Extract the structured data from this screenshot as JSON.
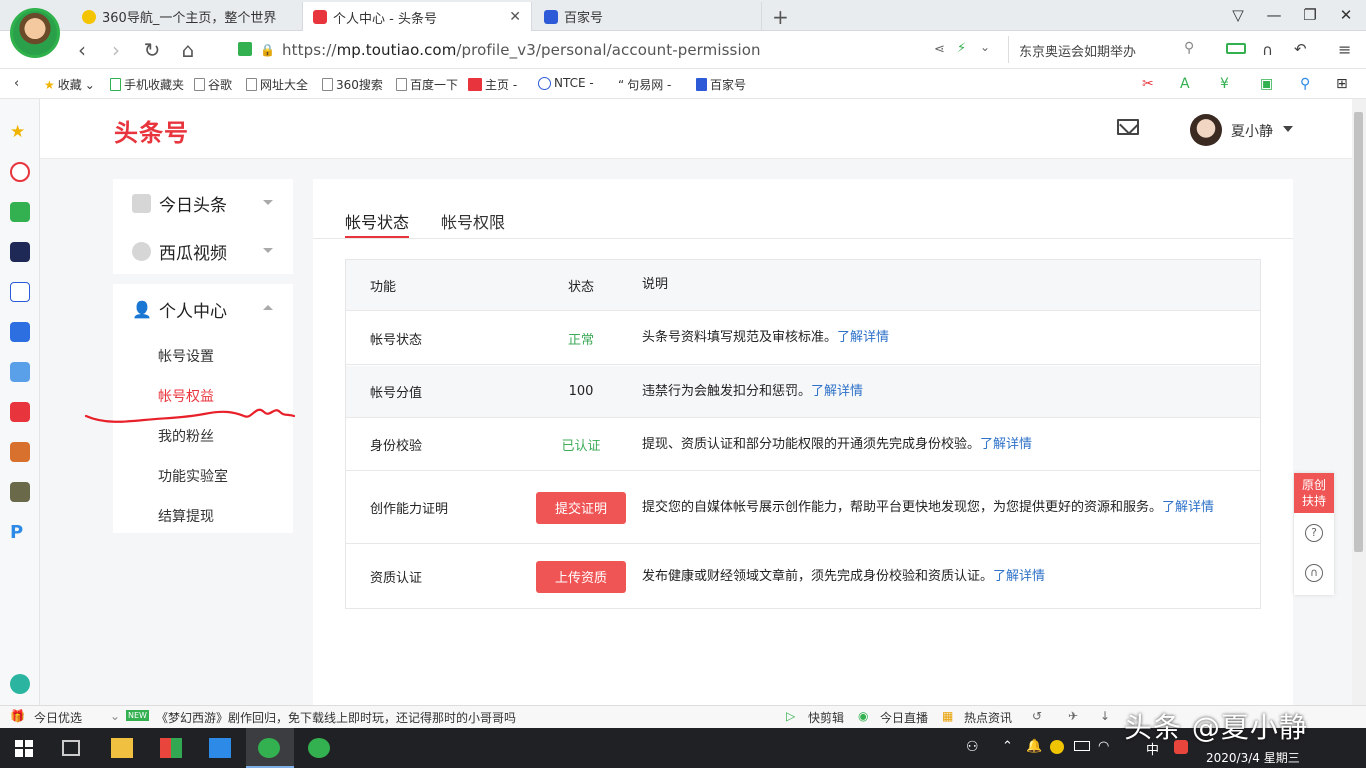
{
  "browser": {
    "tabs": [
      {
        "title": "360导航_一个主页，整个世界"
      },
      {
        "title": "个人中心 - 头条号"
      },
      {
        "title": "百家号"
      }
    ],
    "url_prefix": "https://",
    "url_domain": "mp.toutiao.com",
    "url_path": "/profile_v3/personal/account-permission",
    "search_text": "东京奥运会如期举办",
    "bookmarks": [
      "收藏",
      "手机收藏夹",
      "谷歌",
      "网址大全",
      "360搜索",
      "百度一下",
      "主页 -",
      "NTCE -",
      "句易网 -",
      "百家号"
    ]
  },
  "site": {
    "logo": "头条号",
    "user_name": "夏小静"
  },
  "left_nav": {
    "groups": [
      {
        "label": "今日头条"
      },
      {
        "label": "西瓜视频"
      },
      {
        "label": "个人中心"
      }
    ],
    "sub_items": [
      {
        "label": "帐号设置"
      },
      {
        "label": "帐号权益"
      },
      {
        "label": "我的粉丝"
      },
      {
        "label": "功能实验室"
      },
      {
        "label": "结算提现"
      }
    ]
  },
  "main": {
    "tabs": [
      {
        "label": "帐号状态"
      },
      {
        "label": "帐号权限"
      }
    ],
    "table": {
      "headers": [
        "功能",
        "状态",
        "说明"
      ],
      "rows": [
        {
          "feature": "帐号状态",
          "status": "正常",
          "desc": "头条号资料填写规范及审核标准。",
          "link": "了解详情"
        },
        {
          "feature": "帐号分值",
          "status": "100",
          "desc": "违禁行为会触发扣分和惩罚。",
          "link": "了解详情"
        },
        {
          "feature": "身份校验",
          "status": "已认证",
          "desc": "提现、资质认证和部分功能权限的开通须先完成身份校验。",
          "link": "了解详情"
        },
        {
          "feature": "创作能力证明",
          "action": "提交证明",
          "desc": "提交您的自媒体帐号展示创作能力，帮助平台更快地发现您，为您提供更好的资源和服务。",
          "link": "了解详情"
        },
        {
          "feature": "资质认证",
          "action": "上传资质",
          "desc": "发布健康或财经领域文章前，须先完成身份校验和资质认证。",
          "link": "了解详情"
        }
      ]
    }
  },
  "float_widget": {
    "label": "原创扶持"
  },
  "statusbar": {
    "left": "今日优选",
    "news_badge": "NEW",
    "news": "《梦幻西游》剧作回归，免下载线上即时玩，还记得那时的小哥哥吗",
    "items": [
      "快剪辑",
      "今日直播",
      "热点资讯"
    ]
  },
  "taskbar": {
    "ime": "中",
    "clock": "2020/3/4 星期三"
  },
  "watermark": "头条 @夏小静",
  "colors": {
    "accent": "#e8353d",
    "link": "#2f72c8",
    "ok": "#3dab58",
    "button": "#f05556"
  }
}
